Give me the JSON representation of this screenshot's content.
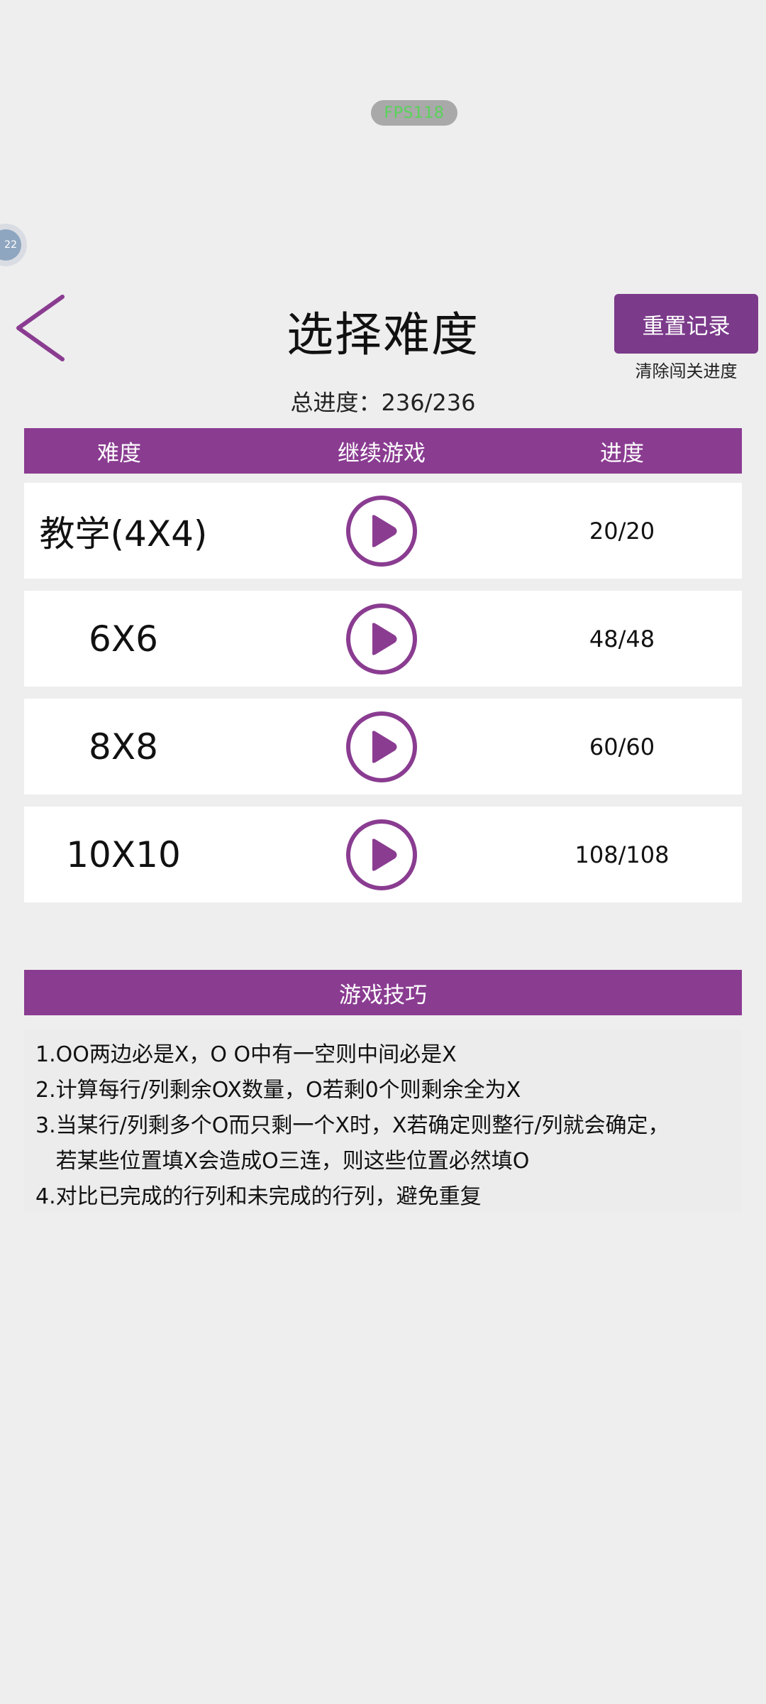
{
  "overlay": {
    "fps_label": "FPS118",
    "bubble_text": "22"
  },
  "header": {
    "title": "选择难度",
    "reset_button": "重置记录",
    "reset_hint": "清除闯关进度",
    "total_progress": "总进度：236/236"
  },
  "table": {
    "headers": [
      "难度",
      "继续游戏",
      "进度"
    ],
    "rows": [
      {
        "name": "教学(4X4)",
        "progress": "20/20"
      },
      {
        "name": "6X6",
        "progress": "48/48"
      },
      {
        "name": "8X8",
        "progress": "60/60"
      },
      {
        "name": "10X10",
        "progress": "108/108"
      }
    ]
  },
  "tips": {
    "title": "游戏技巧",
    "lines": [
      "1.OO两边必是X，O O中有一空则中间必是X",
      "2.计算每行/列剩余OX数量，O若剩0个则剩余全为X",
      "3.当某行/列剩多个O而只剩一个X时，X若确定则整行/列就会确定，",
      "   若某些位置填X会造成O三连，则这些位置必然填O",
      "4.对比已完成的行列和未完成的行列，避免重复"
    ]
  },
  "colors": {
    "accent": "#8a3c91",
    "button": "#7b3a8a",
    "background": "#eeeeee"
  }
}
